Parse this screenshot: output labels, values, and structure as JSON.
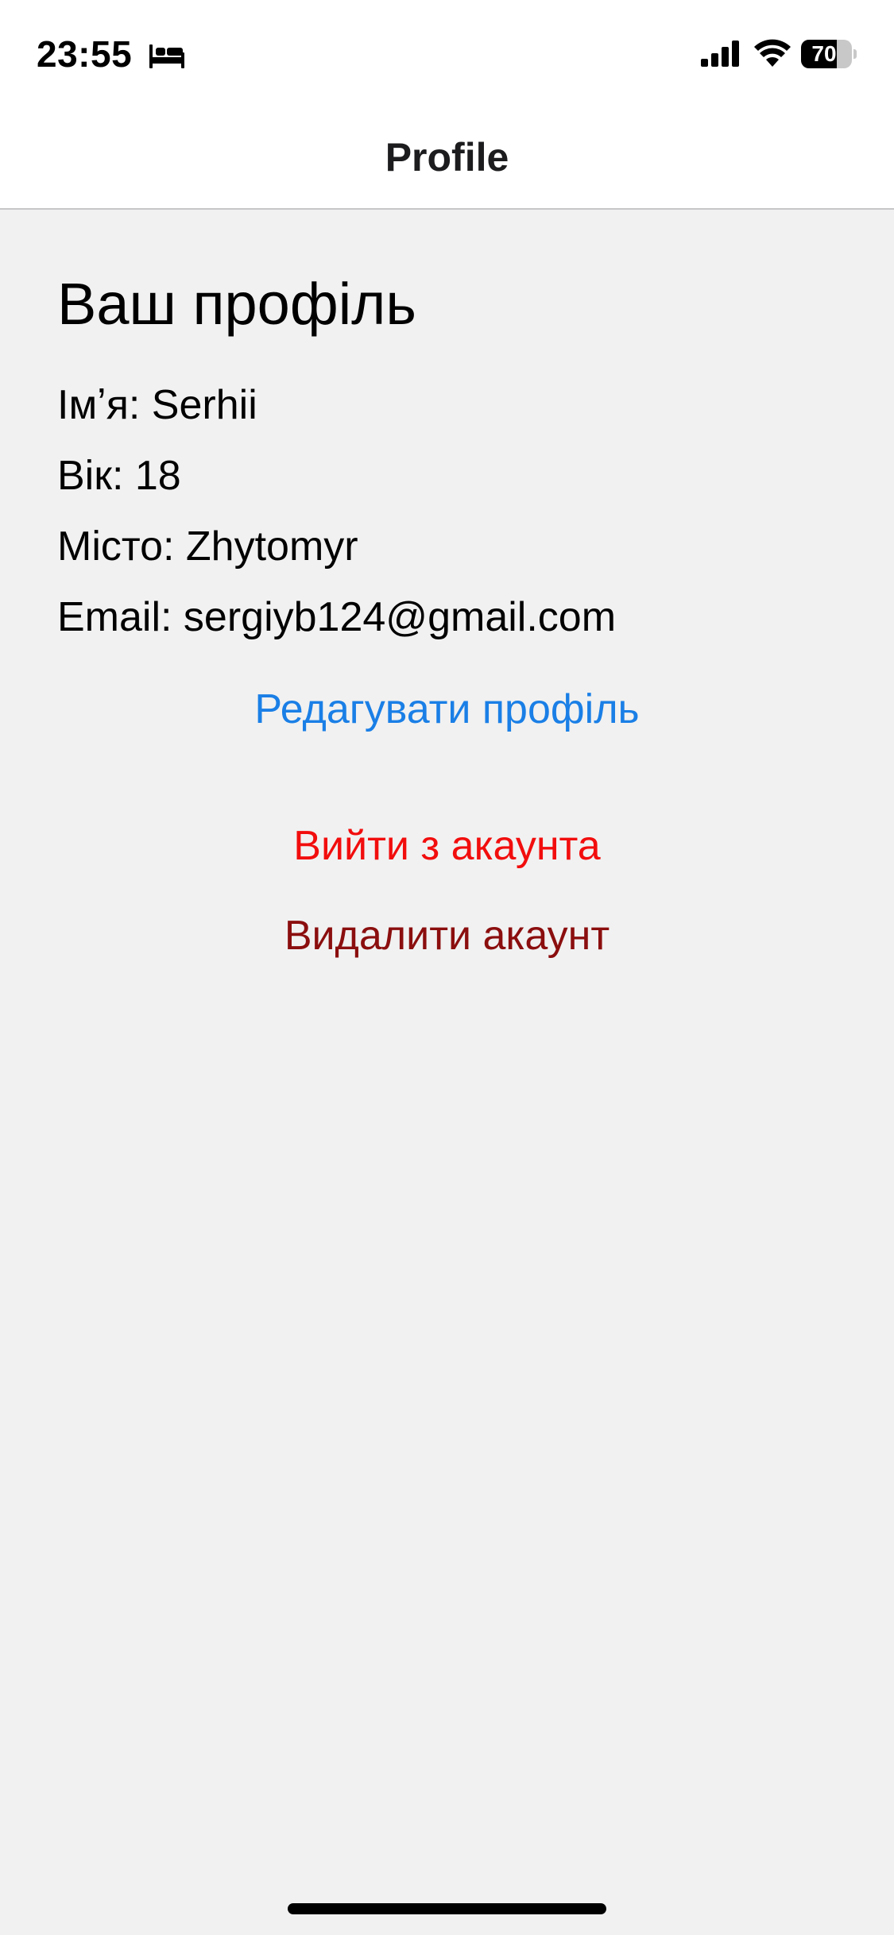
{
  "status_bar": {
    "time": "23:55",
    "battery_level": "70",
    "battery_fraction": 0.7,
    "icons": [
      "bed-icon",
      "cellular-signal-icon",
      "wifi-icon",
      "battery-icon"
    ]
  },
  "nav": {
    "title": "Profile"
  },
  "profile": {
    "heading": "Ваш профіль",
    "name_line": "Імʼя: Serhii",
    "age_line": "Вік: 18",
    "city_line": "Місто: Zhytomyr",
    "email_line": "Email: sergiyb124@gmail.com"
  },
  "actions": {
    "edit_label": "Редагувати профіль",
    "logout_label": "Вийти з акаунта",
    "delete_label": "Видалити акаунт"
  },
  "colors": {
    "background": "#f1f1f1",
    "bar_background": "#ffffff",
    "edit": "#1a7fe6",
    "logout": "#f20d0d",
    "delete": "#8b0e0e"
  }
}
